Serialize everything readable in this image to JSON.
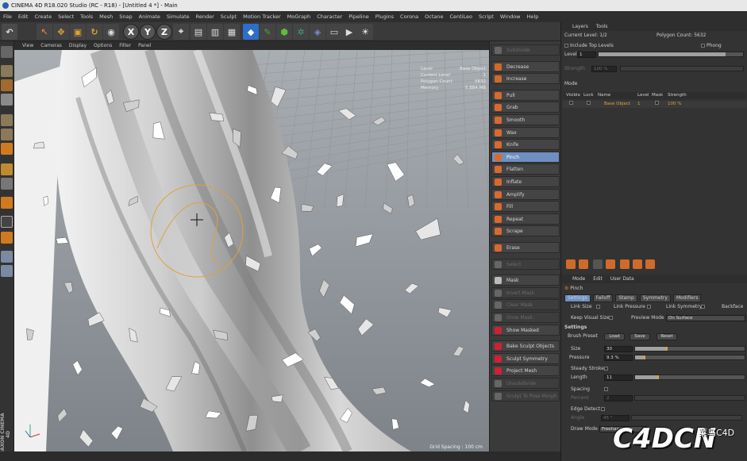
{
  "window": {
    "title": "CINEMA 4D R18.020 Studio (RC - R18) - [Untitled 4 *] - Main"
  },
  "menu": [
    "File",
    "Edit",
    "Create",
    "Select",
    "Tools",
    "Mesh",
    "Snap",
    "Animate",
    "Simulate",
    "Render",
    "Sculpt",
    "Motion Tracker",
    "MoGraph",
    "Character",
    "Pipeline",
    "Plugins",
    "Corona",
    "Octane",
    "CentiLeo",
    "Script",
    "Window",
    "Help"
  ],
  "toolbar": {
    "axis_x": "X",
    "axis_y": "Y",
    "axis_z": "Z"
  },
  "viewport": {
    "menu": [
      "View",
      "Cameras",
      "Display",
      "Options",
      "Filter",
      "Panel"
    ],
    "info": [
      {
        "k": "Layer",
        "v": "Base Object"
      },
      {
        "k": "Current Level",
        "v": "1"
      },
      {
        "k": "Polygon Count",
        "v": "5632"
      },
      {
        "k": "Memory",
        "v": "5.884 MB"
      }
    ],
    "grid_spacing": "Grid Spacing : 100 cm"
  },
  "brushes": {
    "items": [
      {
        "label": "Subdivide",
        "enabled": false,
        "color": "#666"
      },
      {
        "label": "Decrease",
        "enabled": true,
        "color": "#d06a2a"
      },
      {
        "label": "Increase",
        "enabled": true,
        "color": "#d06a2a"
      },
      {
        "label": "Pull",
        "enabled": true,
        "color": "#d86a30"
      },
      {
        "label": "Grab",
        "enabled": true,
        "color": "#d86a30"
      },
      {
        "label": "Smooth",
        "enabled": true,
        "color": "#d86a30"
      },
      {
        "label": "Wax",
        "enabled": true,
        "color": "#d86a30"
      },
      {
        "label": "Knife",
        "enabled": true,
        "color": "#d86a30"
      },
      {
        "label": "Pinch",
        "enabled": true,
        "selected": true,
        "color": "#d86a30"
      },
      {
        "label": "Flatten",
        "enabled": true,
        "color": "#d86a30"
      },
      {
        "label": "Inflate",
        "enabled": true,
        "color": "#d86a30"
      },
      {
        "label": "Amplify",
        "enabled": true,
        "color": "#d86a30"
      },
      {
        "label": "Fill",
        "enabled": true,
        "color": "#d86a30"
      },
      {
        "label": "Repeat",
        "enabled": true,
        "color": "#d86a30"
      },
      {
        "label": "Scrape",
        "enabled": true,
        "color": "#d86a30"
      },
      {
        "label": "Erase",
        "enabled": true,
        "color": "#d86a30"
      },
      {
        "label": "Select",
        "enabled": false,
        "color": "#666"
      },
      {
        "label": "Mask",
        "enabled": true,
        "color": "#bbb"
      },
      {
        "label": "Invert Mask",
        "enabled": false,
        "color": "#666"
      },
      {
        "label": "Clear Mask",
        "enabled": false,
        "color": "#666"
      },
      {
        "label": "Grow Mask",
        "enabled": false,
        "color": "#666"
      },
      {
        "label": "Show Masked",
        "enabled": true,
        "color": "#c23"
      },
      {
        "label": "Bake Sculpt Objects",
        "enabled": true,
        "color": "#c23"
      },
      {
        "label": "Sculpt Symmetry",
        "enabled": true,
        "color": "#c23"
      },
      {
        "label": "Project Mesh",
        "enabled": true,
        "color": "#c23"
      },
      {
        "label": "Unsubdivide",
        "enabled": false,
        "color": "#666"
      },
      {
        "label": "Sculpt To Pose Morph",
        "enabled": false,
        "color": "#666"
      }
    ]
  },
  "layers": {
    "tabs": [
      "Layers",
      "Tools"
    ],
    "current_level": "Current Level: 1/2",
    "polygon_count": "Polygon Count: 5632",
    "include_top_levels": "Include Top Levels",
    "phong": "Phong",
    "level_label": "Level",
    "level_value": "1",
    "strength_label": "Strength",
    "strength_value": "100 %",
    "mode_label": "Mode",
    "columns": [
      "Visible",
      "Lock",
      "Name",
      "Level",
      "Mask",
      "Strength"
    ],
    "rows": [
      {
        "name": "Base Object",
        "level": "1",
        "strength": "100 %"
      }
    ]
  },
  "attributes": {
    "tabs": [
      "Mode",
      "Edit",
      "User Data"
    ],
    "title": "Pinch",
    "subtabs": [
      "Settings",
      "Falloff",
      "Stamp",
      "Symmetry",
      "Modifiers"
    ],
    "link_size": "Link Size",
    "link_pressure": "Link Pressure",
    "link_symmetry": "Link Symmetry",
    "backface": "Backface",
    "keep_visual_size": "Keep Visual Size",
    "preview_mode_label": "Preview Mode",
    "preview_mode_value": "On Surface",
    "settings_header": "Settings",
    "brush_preset": "Brush Preset",
    "load": "Load",
    "save": "Save",
    "reset": "Reset",
    "size_label": "Size",
    "size_value": "30",
    "size_level": 0.3,
    "pressure_label": "Pressure",
    "pressure_value": "9.3 %",
    "pressure_level": 0.093,
    "steady_stroke": "Steady Stroke",
    "length_label": "Length",
    "length_value": "11",
    "spacing": "Spacing",
    "percent_label": "Percent",
    "percent_value": "2",
    "edge_detect": "Edge Detect",
    "angle_label": "Angle",
    "angle_value": "45 °",
    "draw_mode_label": "Draw Mode",
    "draw_mode_value": "Freehand"
  },
  "watermark": {
    "logo": "C4DCN",
    "tagline": "菜鸟C4D"
  }
}
